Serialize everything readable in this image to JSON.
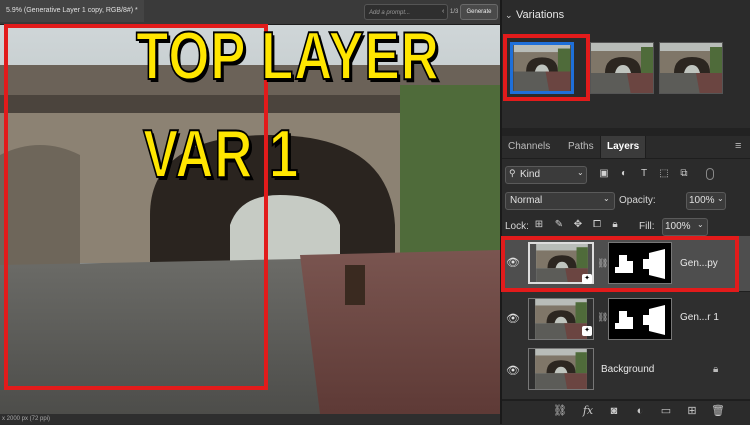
{
  "document": {
    "tab_title": "5.9% (Generative Layer 1 copy, RGB/8#) *",
    "status_text": "x 2000 px (72 ppi)"
  },
  "gen_bar": {
    "prompt_placeholder": "Add a prompt...",
    "counter": "1/3",
    "generate_label": "Generate"
  },
  "overlay": {
    "line1": "TOP LAYER",
    "line2": "VAR 1",
    "color": "#ffe600",
    "highlight_color": "#e21b1b"
  },
  "variations": {
    "header": "Variations",
    "selected_index": 1
  },
  "panel_tabs": {
    "channels": "Channels",
    "paths": "Paths",
    "layers": "Layers"
  },
  "layers_panel": {
    "kind_label": "Kind",
    "blend_mode": "Normal",
    "opacity_label": "Opacity:",
    "opacity_value": "100%",
    "lock_label": "Lock:",
    "fill_label": "Fill:",
    "fill_value": "100%",
    "layers": [
      {
        "name": "Gen...py",
        "selected": true,
        "has_mask": true
      },
      {
        "name": "Gen...r 1",
        "selected": false,
        "has_mask": true
      },
      {
        "name": "Background",
        "selected": false,
        "has_mask": false,
        "locked": true
      }
    ]
  },
  "icons": {
    "eye": "eye-icon",
    "link": "link-icon",
    "fx": "fx-icon",
    "mask": "add-mask-icon",
    "adjust": "adjustment-icon",
    "folder": "new-group-icon",
    "new": "new-layer-icon",
    "trash": "delete-icon"
  },
  "toolbar": {
    "fx_label": "fx"
  },
  "accent": "#1e6fd9"
}
